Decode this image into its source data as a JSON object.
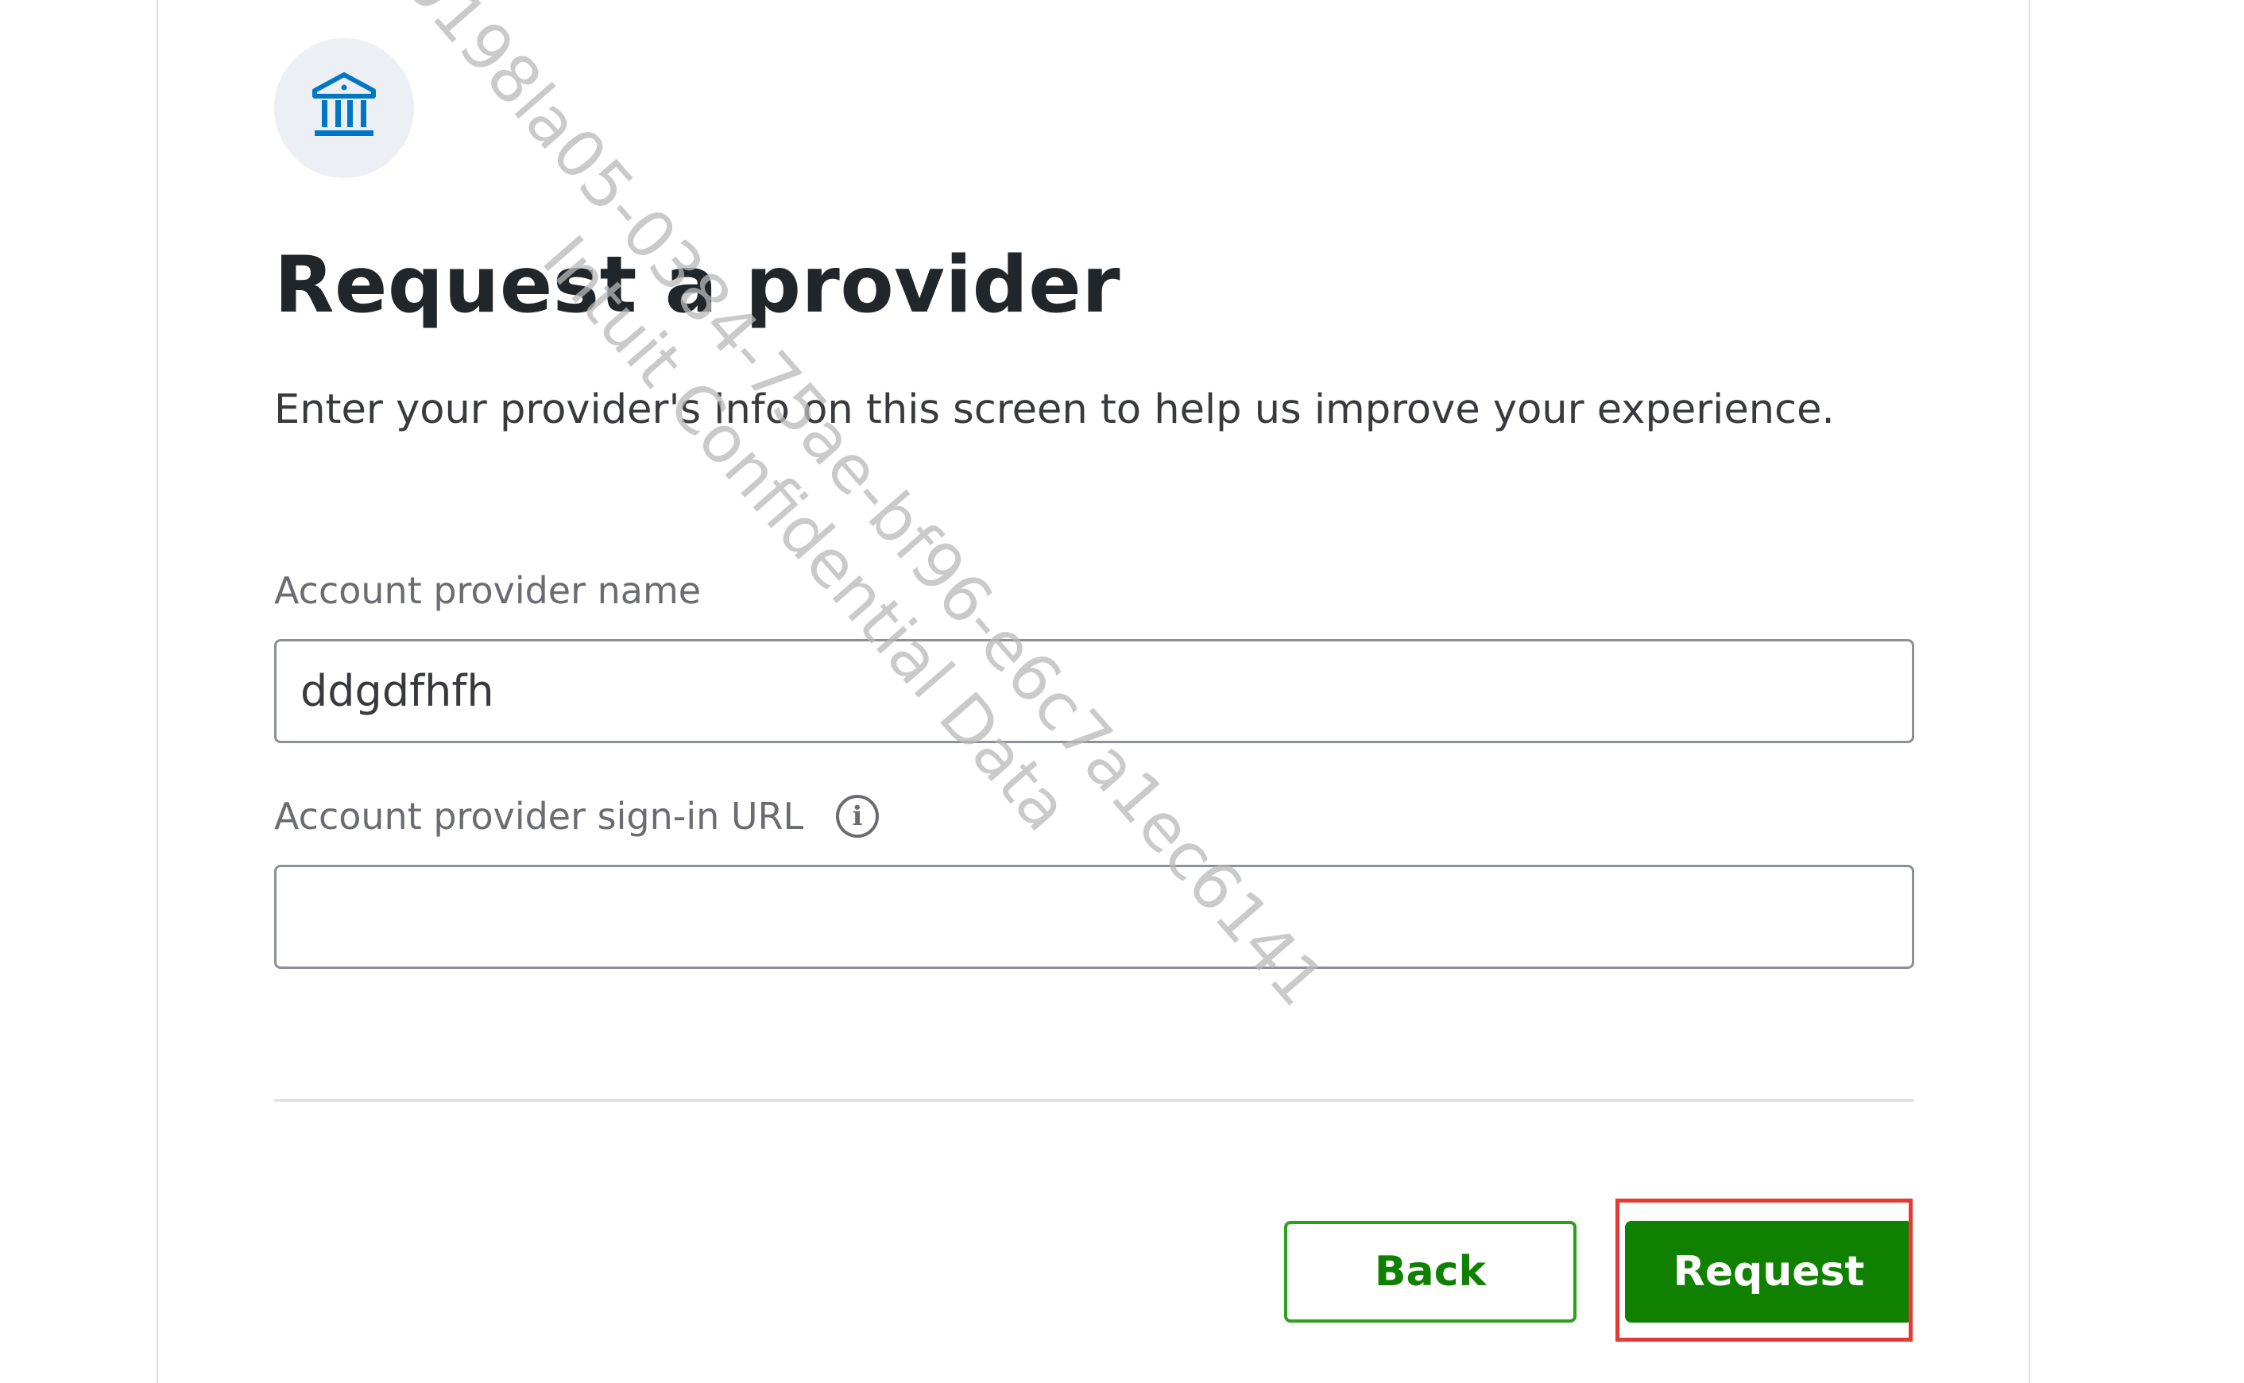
{
  "header": {
    "icon": "bank-icon",
    "title": "Request a provider",
    "subtitle": "Enter your provider's info on this screen to help us improve your experience."
  },
  "form": {
    "provider_name_label": "Account provider name",
    "provider_name_value": "ddgdfhfh",
    "signin_url_label": "Account provider sign-in URL",
    "signin_url_value": "",
    "info_icon": "info-icon"
  },
  "actions": {
    "back_label": "Back",
    "request_label": "Request"
  },
  "watermark": {
    "line1": "0198la05-0384-75ae-bf96-e6c7a1ec6141",
    "line2": "Intuit Confidential Data"
  },
  "colors": {
    "primary_green": "#108000",
    "icon_blue": "#0077c5",
    "highlight_red": "#e53935"
  }
}
